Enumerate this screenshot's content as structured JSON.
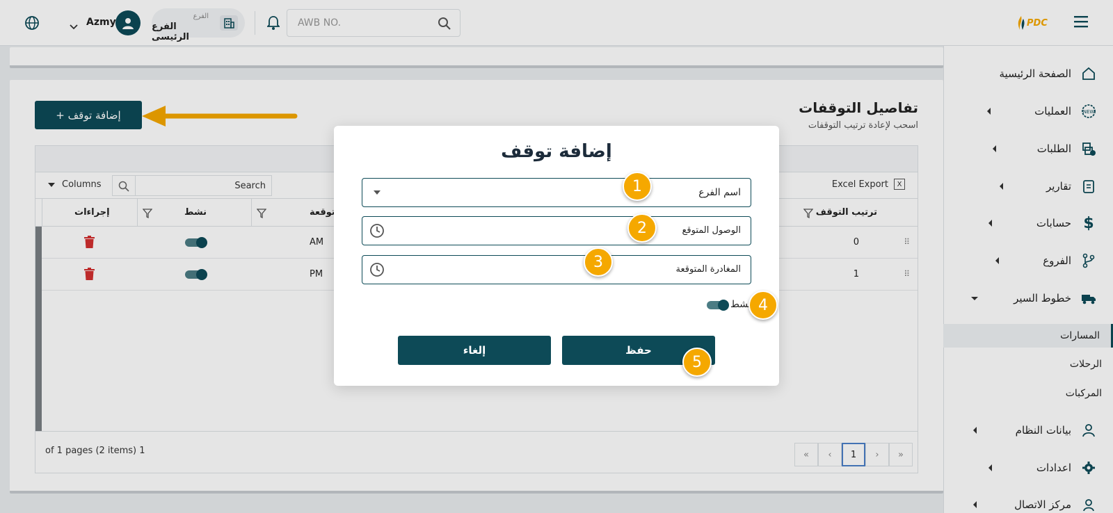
{
  "topbar": {
    "brand": "PDC",
    "search_placeholder": "AWB NO.",
    "branch_caption": "الفرع",
    "branch_name": "الفرع الرئيسى",
    "user_name": "Azmy"
  },
  "sidebar": {
    "items": [
      {
        "label": "الصفحة الرئيسية",
        "icon": "home-icon"
      },
      {
        "label": "العمليات",
        "icon": "new-badge-icon"
      },
      {
        "label": "الطلبات",
        "icon": "boxes-icon"
      },
      {
        "label": "تقارير",
        "icon": "clipboard-icon"
      },
      {
        "label": "حسابات",
        "icon": "dollar-icon"
      },
      {
        "label": "الفروع",
        "icon": "branch-icon"
      },
      {
        "label": "خطوط السير",
        "icon": "truck-icon"
      },
      {
        "label": "بيانات النظام",
        "icon": "user-icon"
      },
      {
        "label": "اعدادات",
        "icon": "gear-icon"
      },
      {
        "label": "مركز الاتصال",
        "icon": "agent-icon"
      }
    ],
    "sub_items": [
      "المسارات",
      "الرحلات",
      "المركبات"
    ]
  },
  "section": {
    "title": "تفاصيل التوقفات",
    "subtitle": "اسحب لإعادة ترتيب التوقفات",
    "add_button": "+ إضافة توقف"
  },
  "grid": {
    "excel_export": "Excel Export",
    "search_placeholder": "Search",
    "columns_label": "Columns",
    "headers": {
      "order": "ترتيب التوقف",
      "expected": "متوقعة",
      "active": "نشط",
      "actions": "إجراءات"
    },
    "rows": [
      {
        "order": "0",
        "time": "AM"
      },
      {
        "order": "1",
        "time": "PM"
      }
    ],
    "pager_info": "of 1 pages (2 items) 1",
    "current_page": "1",
    "pager_first": "«",
    "pager_prev": "‹",
    "pager_next": "›",
    "pager_last": "»"
  },
  "modal": {
    "title": "إضافة توقف",
    "branch_name_label": "اسم الفرع",
    "expected_arrival_label": "الوصول المتوقع",
    "expected_departure_label": "المغادرة المتوقعة",
    "active_label": "نشط",
    "save_button": "حفظ",
    "cancel_button": "إلغاء"
  },
  "annotations": [
    "1",
    "2",
    "3",
    "4",
    "5"
  ],
  "colors": {
    "primary": "#0d4a57",
    "badge": "#f5a800",
    "delete": "#d32f2f"
  }
}
